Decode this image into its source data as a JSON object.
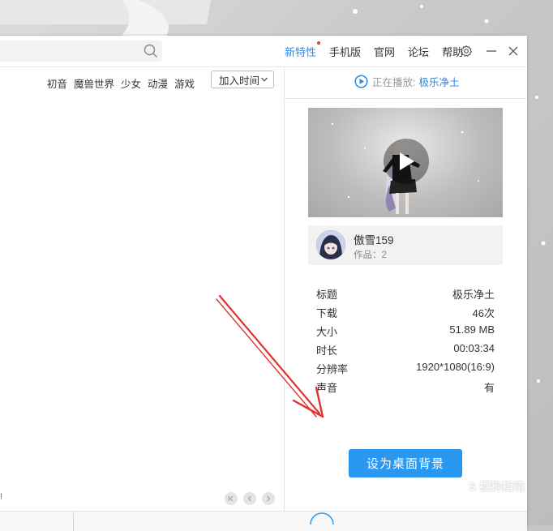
{
  "nav": {
    "items": [
      {
        "label": "新特性",
        "active": true,
        "dot": true
      },
      {
        "label": "手机版"
      },
      {
        "label": "官网"
      },
      {
        "label": "论坛"
      },
      {
        "label": "帮助"
      }
    ]
  },
  "tags": [
    "初音",
    "魔兽世界",
    "少女",
    "动漫",
    "游戏"
  ],
  "sort": {
    "label": "加入时间"
  },
  "now_playing": {
    "label": "正在播放:",
    "title": "极乐净土"
  },
  "author": {
    "name": "傲雪159",
    "works": "作品：2"
  },
  "details": [
    {
      "key": "标题",
      "value": "极乐净土"
    },
    {
      "key": "下载",
      "value": "46次"
    },
    {
      "key": "大小",
      "value": "51.89 MB"
    },
    {
      "key": "时长",
      "value": "00:03:34"
    },
    {
      "key": "分辨率",
      "value": "1920*1080(16:9)"
    },
    {
      "key": "声音",
      "value": "有"
    }
  ],
  "set_bg_button": "设为桌面背景",
  "left_note": "!",
  "watermark": "S 搜狗指南",
  "colors": {
    "accent": "#2a8ae6",
    "button": "#2a97f0",
    "arrow": "#e0312f"
  }
}
